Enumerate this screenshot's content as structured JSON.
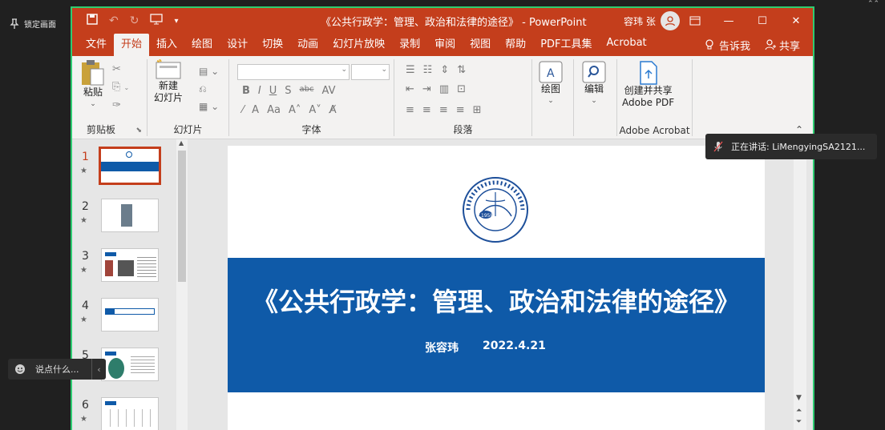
{
  "overlay": {
    "pin_label": "锁定画面",
    "speaker_label": "正在讲话: LiMengyingSA2121...",
    "chat_placeholder": "说点什么..."
  },
  "window": {
    "title": "《公共行政学：管理、政治和法律的途径》 - PowerPoint",
    "user_name": "容玮 张",
    "accent_color": "#c43e1c",
    "frame_color": "#2ecc71"
  },
  "menu": {
    "tabs": [
      "文件",
      "开始",
      "插入",
      "绘图",
      "设计",
      "切换",
      "动画",
      "幻灯片放映",
      "录制",
      "审阅",
      "视图",
      "帮助",
      "PDF工具集",
      "Acrobat"
    ],
    "active_tab": "开始",
    "tell_me": "告诉我",
    "share": "共享"
  },
  "ribbon": {
    "paste": "粘贴",
    "clipboard": "剪贴板",
    "new_slide_line1": "新建",
    "new_slide_line2": "幻灯片",
    "slides_group": "幻灯片",
    "font_group": "字体",
    "paragraph_group": "段落",
    "draw": "绘图",
    "edit": "编辑",
    "create_share_line1": "创建并共享",
    "create_share_line2": "Adobe PDF",
    "adobe_group": "Adobe Acrobat"
  },
  "thumbnails": [
    "1",
    "2",
    "3",
    "4",
    "5",
    "6"
  ],
  "selected_slide": 1,
  "slide": {
    "title": "《公共行政学：管理、政治和法律的途径》",
    "author": "张容玮",
    "date": "2022.4.21",
    "band_color": "#0f5aa8",
    "logo_year": "1958"
  }
}
